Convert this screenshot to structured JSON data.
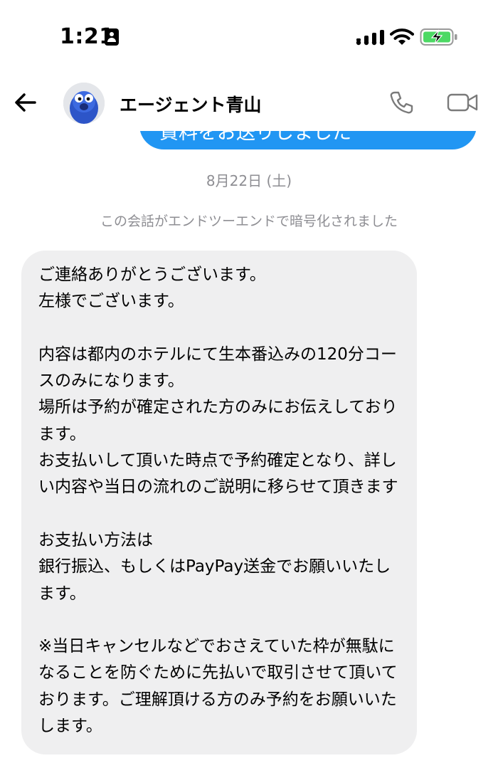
{
  "status_bar": {
    "time": "1:21",
    "icons": [
      "id-card-icon",
      "signal-icon",
      "wifi-icon",
      "battery-charging-icon"
    ]
  },
  "header": {
    "contact_name": "エージェント青山",
    "back_icon": "arrow-left-icon",
    "actions": [
      "phone-icon",
      "video-camera-icon"
    ]
  },
  "sent_message": {
    "text": "資料をお送りしました",
    "color": "#2196f3"
  },
  "date_separator": "8月22日 (土)",
  "encryption_notice": "この会話がエンドツーエンドで暗号化されました",
  "received_message": {
    "text": "ご連絡ありがとうございます。\n左様でございます。\n\n内容は都内のホテルにて生本番込みの120分コースのみになります。\n場所は予約が確定された方のみにお伝えしております。\nお支払いして頂いた時点で予約確定となり、詳しい内容や当日の流れのご説明に移らせて頂きます\n\nお支払い方法は\n銀行振込、もしくはPayPay送金でお願いいたします。\n\n※当日キャンセルなどでおさえていた枠が無駄になることを防ぐために先払いで取引させて頂いております。ご理解頂ける方のみ予約をお願いいたします。",
    "bubble_color": "#efeff0"
  },
  "colors": {
    "accent": "#2196f3",
    "muted_text": "#8e8e93",
    "battery_green": "#4cd964"
  }
}
